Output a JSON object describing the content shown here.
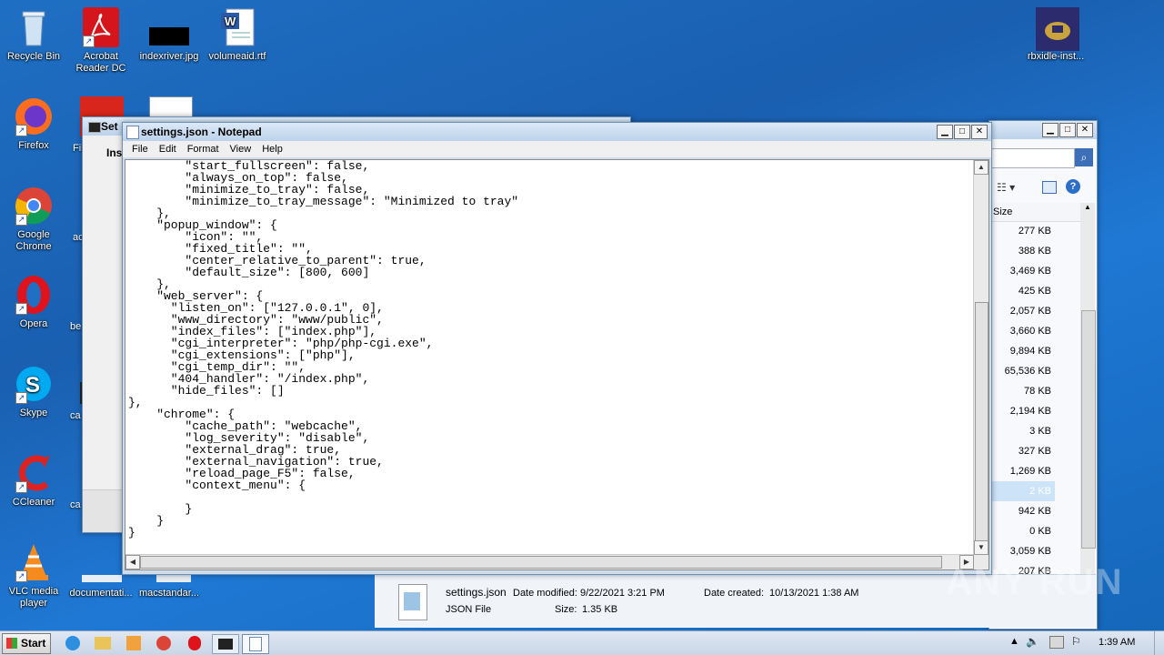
{
  "desktop_icons": [
    {
      "label": "Recycle Bin"
    },
    {
      "label": "Acrobat Reader DC"
    },
    {
      "label": "indexriver.jpg"
    },
    {
      "label": "volumeaid.rtf"
    },
    {
      "label": "rbxidle-inst..."
    },
    {
      "label": "Firefox"
    },
    {
      "label": "Google Chrome"
    },
    {
      "label": "Opera"
    },
    {
      "label": "Skype"
    },
    {
      "label": "CCleaner"
    },
    {
      "label": "VLC media player"
    },
    {
      "label": "documentati..."
    },
    {
      "label": "macstandar..."
    }
  ],
  "partial_labels": {
    "fil": "Fil",
    "ac": "ac",
    "be": "be",
    "ca1": "ca",
    "ca2": "ca",
    "ca3": "ca"
  },
  "installer": {
    "title": "Set",
    "label": "Ins"
  },
  "notepad": {
    "title": "settings.json - Notepad",
    "menu": [
      "File",
      "Edit",
      "Format",
      "View",
      "Help"
    ],
    "content": "        \"start_fullscreen\": false,\n        \"always_on_top\": false,\n        \"minimize_to_tray\": false,\n        \"minimize_to_tray_message\": \"Minimized to tray\"\n    },\n    \"popup_window\": {\n        \"icon\": \"\",\n        \"fixed_title\": \"\",\n        \"center_relative_to_parent\": true,\n        \"default_size\": [800, 600]\n    },\n    \"web_server\": {\n      \"listen_on\": [\"127.0.0.1\", 0],\n      \"www_directory\": \"www/public\",\n      \"index_files\": [\"index.php\"],\n      \"cgi_interpreter\": \"php/php-cgi.exe\",\n      \"cgi_extensions\": [\"php\"],\n      \"cgi_temp_dir\": \"\",\n      \"404_handler\": \"/index.php\",\n      \"hide_files\": []\n},\n    \"chrome\": {\n        \"cache_path\": \"webcache\",\n        \"log_severity\": \"disable\",\n        \"external_drag\": true,\n        \"external_navigation\": true,\n        \"reload_page_F5\": false,\n        \"context_menu\": {\n\n        }\n    }\n}"
  },
  "explorer": {
    "size_header": "Size",
    "sizes": [
      "277 KB",
      "388 KB",
      "3,469 KB",
      "425 KB",
      "2,057 KB",
      "3,660 KB",
      "9,894 KB",
      "65,536 KB",
      "78 KB",
      "2,194 KB",
      "3 KB",
      "327 KB",
      "1,269 KB",
      "2 KB",
      "942 KB",
      "0 KB",
      "3,059 KB",
      "207 KB"
    ],
    "selected_index": 13,
    "details": {
      "filename": "settings.json",
      "filetype": "JSON File",
      "modified_label": "Date modified:",
      "modified_value": "9/22/2021 3:21 PM",
      "created_label": "Date created:",
      "created_value": "10/13/2021 1:38 AM",
      "size_label": "Size:",
      "size_value": "1.35 KB"
    }
  },
  "taskbar": {
    "start_label": "Start",
    "clock": "1:39 AM"
  },
  "watermark": "ANY RUN"
}
